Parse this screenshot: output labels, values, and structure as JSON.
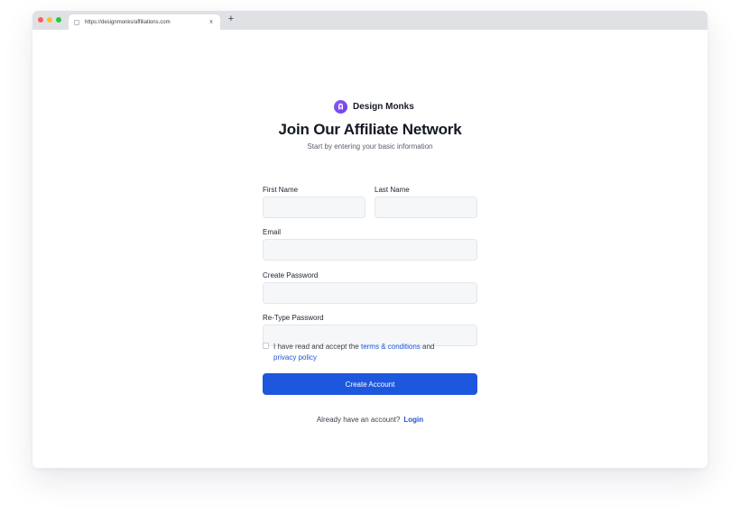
{
  "browser": {
    "tab_url": "https://designmonks/affiliations.com",
    "tab_close": "x",
    "new_tab": "+"
  },
  "brand": {
    "name": "Design Monks"
  },
  "form": {
    "title": "Join Our Affiliate Network",
    "subtitle": "Start by entering your basic information",
    "first_name_label": "First Name",
    "last_name_label": "Last Name",
    "email_label": "Email",
    "password_label": "Create Password",
    "retype_password_label": "Re-Type Password",
    "first_name_value": "",
    "last_name_value": "",
    "email_value": "",
    "password_value": "",
    "retype_password_value": "",
    "terms_prefix": "I have read and accept the ",
    "terms_link": "terms & conditions",
    "terms_and": " and",
    "privacy_link": "privacy policy",
    "create_button": "Create Account",
    "already_text": "Already have an account?",
    "login_link": "Login"
  },
  "colors": {
    "accent": "#1d57de",
    "logo": "#7c4ef2",
    "field_bg": "#f6f7f9"
  }
}
